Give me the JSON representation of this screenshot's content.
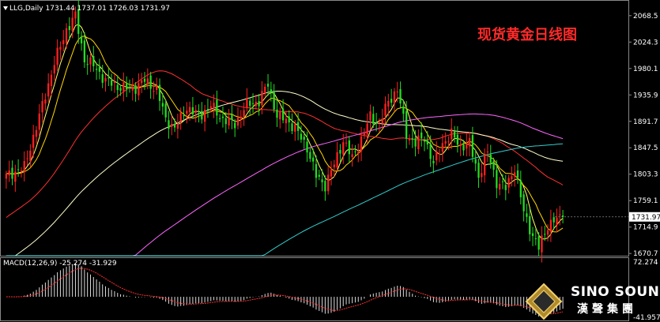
{
  "header": {
    "symbol_line": "LLG,Daily  1731.44 1737.01 1726.03 1731.97"
  },
  "title": "现货黄金日线图",
  "macd": {
    "label": "MACD(12,26,9) -25.274 -31.929",
    "axis_top": "72.274",
    "axis_bottom": "-41.957"
  },
  "logo": {
    "name_en": "SINO SOUND",
    "name_cn": "漢聲集團"
  },
  "colors": {
    "background": "#000000",
    "up_candle": "#ff2020",
    "down_candle": "#22dd22",
    "ma_fast": "#ffff66",
    "ma_mid": "#ff3030",
    "ma_long": "#ffffcc",
    "ma_200": "#ff66ff",
    "ma_300": "#33cccc",
    "price_label_bg": "#ffffff"
  },
  "chart_data": {
    "type": "candlestick",
    "y_ticks": [
      2068.5,
      2024.3,
      1980.1,
      1935.9,
      1891.7,
      1847.5,
      1803.3,
      1759.1,
      1714.9,
      1670.7
    ],
    "ylim": [
      1667.0,
      2092.0
    ],
    "current_price": 1731.97,
    "key_points": [
      {
        "i": 0,
        "c": 1800
      },
      {
        "i": 6,
        "c": 1815
      },
      {
        "i": 11,
        "c": 1900
      },
      {
        "i": 16,
        "c": 1990
      },
      {
        "i": 20,
        "c": 2045
      },
      {
        "i": 23,
        "c": 2068
      },
      {
        "i": 26,
        "c": 1995
      },
      {
        "i": 29,
        "c": 1985
      },
      {
        "i": 33,
        "c": 1960
      },
      {
        "i": 37,
        "c": 1950
      },
      {
        "i": 42,
        "c": 1945
      },
      {
        "i": 46,
        "c": 1960
      },
      {
        "i": 50,
        "c": 1945
      },
      {
        "i": 53,
        "c": 1895
      },
      {
        "i": 56,
        "c": 1880
      },
      {
        "i": 60,
        "c": 1915
      },
      {
        "i": 64,
        "c": 1900
      },
      {
        "i": 68,
        "c": 1918
      },
      {
        "i": 72,
        "c": 1895
      },
      {
        "i": 76,
        "c": 1888
      },
      {
        "i": 80,
        "c": 1920
      },
      {
        "i": 84,
        "c": 1925
      },
      {
        "i": 87,
        "c": 1955
      },
      {
        "i": 90,
        "c": 1900
      },
      {
        "i": 93,
        "c": 1895
      },
      {
        "i": 96,
        "c": 1880
      },
      {
        "i": 100,
        "c": 1848
      },
      {
        "i": 103,
        "c": 1800
      },
      {
        "i": 106,
        "c": 1785
      },
      {
        "i": 109,
        "c": 1820
      },
      {
        "i": 112,
        "c": 1860
      },
      {
        "i": 115,
        "c": 1830
      },
      {
        "i": 118,
        "c": 1862
      },
      {
        "i": 121,
        "c": 1900
      },
      {
        "i": 124,
        "c": 1888
      },
      {
        "i": 127,
        "c": 1925
      },
      {
        "i": 130,
        "c": 1945
      },
      {
        "i": 133,
        "c": 1870
      },
      {
        "i": 136,
        "c": 1855
      },
      {
        "i": 139,
        "c": 1865
      },
      {
        "i": 142,
        "c": 1820
      },
      {
        "i": 145,
        "c": 1855
      },
      {
        "i": 148,
        "c": 1870
      },
      {
        "i": 151,
        "c": 1850
      },
      {
        "i": 154,
        "c": 1855
      },
      {
        "i": 157,
        "c": 1800
      },
      {
        "i": 160,
        "c": 1840
      },
      {
        "i": 163,
        "c": 1790
      },
      {
        "i": 166,
        "c": 1780
      },
      {
        "i": 169,
        "c": 1815
      },
      {
        "i": 172,
        "c": 1740
      },
      {
        "i": 175,
        "c": 1700
      },
      {
        "i": 177,
        "c": 1680
      },
      {
        "i": 180,
        "c": 1718
      },
      {
        "i": 182,
        "c": 1725
      },
      {
        "i": 185,
        "c": 1731.97
      }
    ]
  }
}
